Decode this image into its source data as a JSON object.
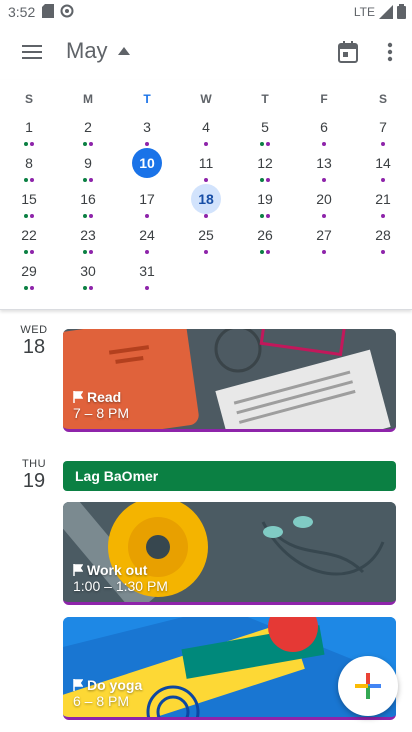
{
  "status": {
    "time": "3:52",
    "network": "LTE"
  },
  "header": {
    "month": "May"
  },
  "calendar": {
    "weekdays": [
      "S",
      "M",
      "T",
      "W",
      "T",
      "F",
      "S"
    ],
    "today_index": 2,
    "weeks": [
      [
        "1",
        "2",
        "3",
        "4",
        "5",
        "6",
        "7"
      ],
      [
        "8",
        "9",
        "10",
        "11",
        "12",
        "13",
        "14"
      ],
      [
        "15",
        "16",
        "17",
        "18",
        "19",
        "20",
        "21"
      ],
      [
        "22",
        "23",
        "24",
        "25",
        "26",
        "27",
        "28"
      ],
      [
        "29",
        "30",
        "31",
        "",
        "",
        "",
        ""
      ]
    ],
    "selected_day": "10",
    "viewing_day": "18"
  },
  "agenda": {
    "days": [
      {
        "dow": "WED",
        "date": "18"
      },
      {
        "dow": "THU",
        "date": "19"
      }
    ],
    "events": [
      {
        "title": "Read",
        "time": "7 – 8 PM"
      },
      {
        "title": "Lag BaOmer"
      },
      {
        "title": "Work out",
        "time": "1:00 – 1:30 PM"
      },
      {
        "title": "Do yoga",
        "time": "6 – 8 PM"
      }
    ]
  },
  "colors": {
    "accent": "#1a73e8",
    "event_purple": "#8e24aa",
    "holiday_green": "#0b8043"
  }
}
